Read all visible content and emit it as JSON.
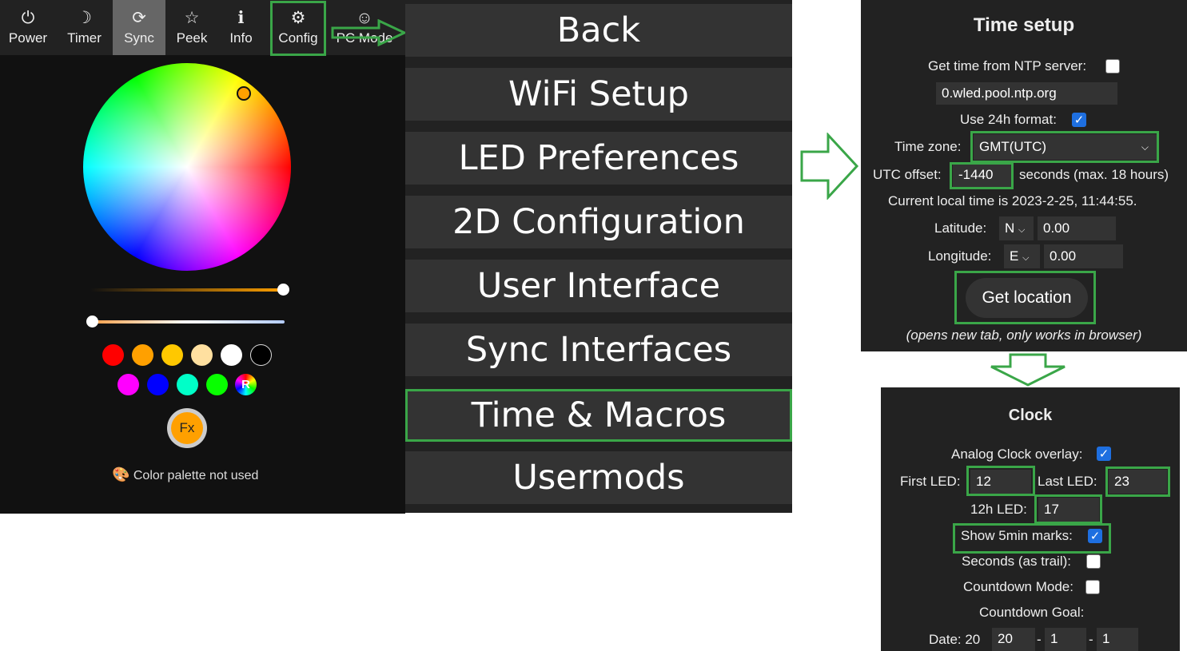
{
  "main_ui": {
    "tabs": [
      {
        "label": "Power",
        "icon": "power-icon",
        "glyph": "⏻"
      },
      {
        "label": "Timer",
        "icon": "moon-icon",
        "glyph": "☽"
      },
      {
        "label": "Sync",
        "icon": "sync-icon",
        "glyph": "⟳"
      },
      {
        "label": "Peek",
        "icon": "star-icon",
        "glyph": "☆"
      },
      {
        "label": "Info",
        "icon": "info-icon",
        "glyph": "ℹ"
      },
      {
        "label": "Config",
        "icon": "gear-icon",
        "glyph": "⚙"
      },
      {
        "label": "PC Mode",
        "icon": "palette-icon",
        "glyph": "☺"
      }
    ],
    "swatches": [
      "#ff0000",
      "#ffa000",
      "#ffc800",
      "#ffe0a0",
      "#ffffff",
      "#000000",
      "#ff00ff",
      "#0000ff",
      "#00ffc8",
      "#08ff00"
    ],
    "random_swatch_label": "R",
    "fx_label": "Fx",
    "palette_note": "Color palette not used",
    "accent_color": "#ffa000"
  },
  "settings_menu": {
    "items": [
      "Back",
      "WiFi Setup",
      "LED Preferences",
      "2D Configuration",
      "User Interface",
      "Sync Interfaces",
      "Time & Macros",
      "Usermods"
    ]
  },
  "time_setup": {
    "title": "Time setup",
    "ntp_label": "Get time from NTP server:",
    "ntp_checked": false,
    "ntp_server": "0.wled.pool.ntp.org",
    "h24_label": "Use 24h format:",
    "h24_checked": true,
    "timezone_label": "Time zone:",
    "timezone_value": "GMT(UTC)",
    "utc_label": "UTC offset:",
    "utc_value": "-1440",
    "utc_suffix": "seconds (max. 18 hours)",
    "local_time": "Current local time is 2023-2-25, 11:44:55.",
    "lat_label": "Latitude:",
    "lat_dir": "N",
    "lat_value": "0.00",
    "lon_label": "Longitude:",
    "lon_dir": "E",
    "lon_value": "0.00",
    "get_location": "Get location",
    "location_note": "(opens new tab, only works in browser)"
  },
  "clock": {
    "title": "Clock",
    "overlay_label": "Analog Clock overlay:",
    "overlay_checked": true,
    "first_led_label": "First LED:",
    "first_led": "12",
    "last_led_label": "Last LED:",
    "last_led": "23",
    "h12_led_label": "12h LED:",
    "h12_led": "17",
    "marks_label": "Show 5min marks:",
    "marks_checked": true,
    "seconds_label": "Seconds (as trail):",
    "seconds_checked": false,
    "countdown_label": "Countdown Mode:",
    "countdown_checked": false,
    "goal_label": "Countdown Goal:",
    "date_label": "Date: 20",
    "date_year": "20",
    "date_sep": "-",
    "date_month": "1",
    "date_day": "1"
  },
  "colors": {
    "highlight": "#3aa648",
    "panel_bg": "#222222",
    "menu_button": "#333333",
    "checkbox_on": "#1e6fe0"
  }
}
